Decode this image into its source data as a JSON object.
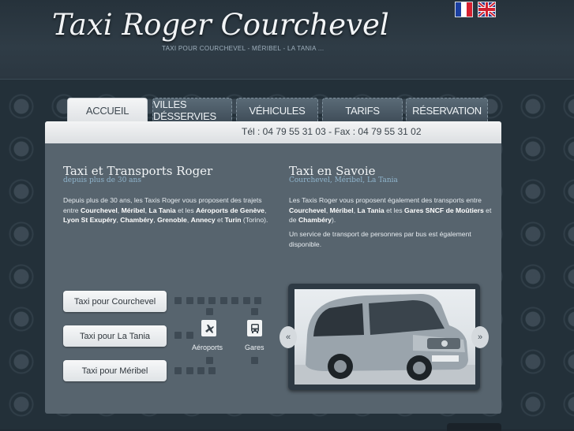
{
  "header": {
    "logo": "Taxi Roger Courchevel",
    "tagline": "TAXI POUR COURCHEVEL - MÉRIBEL - LA TANIA ...",
    "flags": [
      "french-flag-icon",
      "uk-flag-icon"
    ]
  },
  "nav": {
    "tabs": [
      {
        "label": "ACCUEIL"
      },
      {
        "label": "VILLES DÉSSERVIES"
      },
      {
        "label": "VÉHICULES"
      },
      {
        "label": "TARIFS"
      },
      {
        "label": "RÉSERVATION"
      }
    ]
  },
  "contact": {
    "phone": "Tél : 04 79 55 31 03 - Fax : 04 79 55 31 02"
  },
  "left": {
    "title": "Taxi et Transports Roger",
    "subtitle": "depuis plus de 30 ans",
    "p1_a": "Depuis plus de 30 ans, les Taxis Roger vous proposent des trajets entre ",
    "p1_courchevel": "Courchevel",
    "p1_sep1": ", ",
    "p1_meribel": "Méribel",
    "p1_sep2": ", ",
    "p1_latania": "La Tania",
    "p1_b": " et les ",
    "p1_airports": "Aéroports de Genève",
    "p1_sep3": ", ",
    "p1_lyon": "Lyon St Exupéry",
    "p1_sep4": ", ",
    "p1_chambery": "Chambéry",
    "p1_sep5": ", ",
    "p1_grenoble": "Grenoble",
    "p1_sep6": ", ",
    "p1_annecy": "Annecy",
    "p1_c": " et ",
    "p1_turin": "Turin",
    "p1_d": " (Torino)."
  },
  "right": {
    "title": "Taxi en Savoie",
    "subtitle": "Courchevel, Méribel, La Tania",
    "p1_a": "Les Taxis Roger vous proposent également des transports entre ",
    "p1_courchevel": "Courchevel",
    "p1_sep1": ", ",
    "p1_meribel": "Méribel",
    "p1_sep2": ", ",
    "p1_latania": "La Tania",
    "p1_b": " et les ",
    "p1_gares": "Gares SNCF de Moûtiers",
    "p1_c": " et de ",
    "p1_chambery": "Chambéry",
    "p1_d": ").",
    "p2": "Un service de transport de personnes par bus est également disponible."
  },
  "buttons": {
    "courchevel": "Taxi pour Courchevel",
    "latania": "Taxi pour La Tania",
    "meribel": "Taxi pour Méribel"
  },
  "icons": {
    "airports_label": "Aéroports",
    "stations_label": "Gares"
  }
}
